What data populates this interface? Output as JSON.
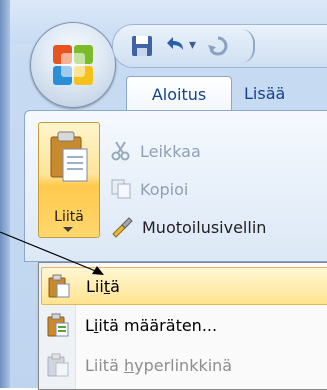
{
  "tabs": {
    "active": "Aloitus",
    "other": "Lisää"
  },
  "clipboard": {
    "paste_label": "Liitä",
    "cut_label": "Leikkaa",
    "copy_label": "Kopioi",
    "format_painter_label": "Muotoilusivellin"
  },
  "paste_menu": {
    "items": [
      {
        "pre": "Lii",
        "ul": "t",
        "post": "ä"
      },
      {
        "pre": "L",
        "ul": "i",
        "post": "itä määräten..."
      },
      {
        "pre": "Liitä ",
        "ul": "h",
        "post": "yperlinkkinä"
      }
    ]
  },
  "colors": {
    "accent_blue": "#15428b",
    "highlight": "#ffe38f",
    "disabled_text": "#8f9fb5"
  },
  "icons": [
    "office-button-logo",
    "save-icon",
    "undo-icon",
    "redo-icon",
    "scissors-icon",
    "copy-icon",
    "brush-icon",
    "clipboard-icon"
  ]
}
